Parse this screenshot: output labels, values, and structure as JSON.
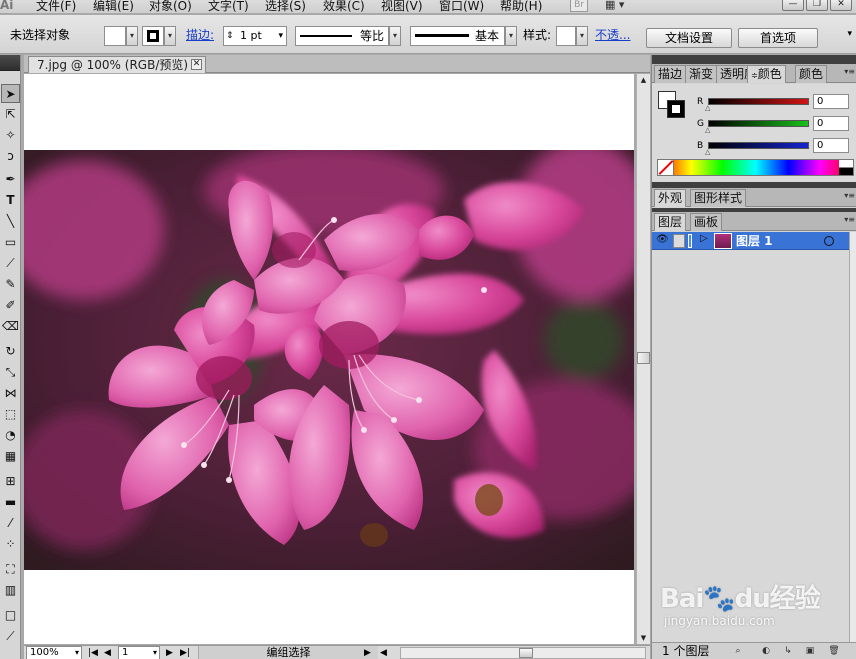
{
  "app": {
    "logo": "Ai",
    "bridge_label": "Br"
  },
  "menu": [
    "文件(F)",
    "编辑(E)",
    "对象(O)",
    "文字(T)",
    "选择(S)",
    "效果(C)",
    "视图(V)",
    "窗口(W)",
    "帮助(H)"
  ],
  "window_buttons": {
    "minimize": "—",
    "restore": "❐",
    "close": "✕"
  },
  "control": {
    "selection_status": "未选择对象",
    "stroke_link": "描边:",
    "stroke_weight": "1 pt",
    "profile_label": "等比",
    "brush_label": "基本",
    "style_label": "样式:",
    "opacity_link": "不透...",
    "doc_setup_button": "文档设置",
    "preferences_button": "首选项"
  },
  "document": {
    "tab_title": "7.jpg @ 100% (RGB/预览)",
    "close": "✕"
  },
  "status": {
    "zoom": "100%",
    "page": "1",
    "state": "编组选择"
  },
  "color_panel": {
    "tabs": [
      "描边",
      "渐变",
      "透明度",
      "颜色",
      "颜色"
    ],
    "active_tab": "颜色",
    "channels": [
      {
        "label": "R",
        "value": "0",
        "color": "#d01515"
      },
      {
        "label": "G",
        "value": "0",
        "color": "#18c018"
      },
      {
        "label": "B",
        "value": "0",
        "color": "#1525d0"
      }
    ]
  },
  "appearance_panel": {
    "tabs": [
      "外观",
      "图形样式"
    ]
  },
  "layers_panel": {
    "tabs": [
      "图层",
      "画板"
    ],
    "layers": [
      {
        "name": "图层 1",
        "color": "#4d8cff"
      }
    ],
    "count_label": "1 个图层"
  },
  "watermark": {
    "brand": "Bai🐾du经验",
    "url": "jingyan.baidu.com"
  }
}
